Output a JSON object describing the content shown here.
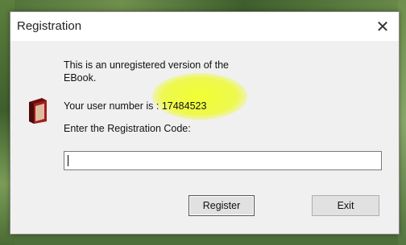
{
  "dialog": {
    "title": "Registration",
    "close_glyph": "✕",
    "message_line1": "This is an unregistered version of the",
    "message_line2": "EBook.",
    "user_number_label": "Your user number is : ",
    "user_number": "17484523",
    "registration_prompt": "Enter the Registration Code:",
    "registration_code_value": "",
    "register_label": "Register",
    "exit_label": "Exit"
  },
  "icons": {
    "dialog_icon": "book-icon",
    "close_icon": "close-icon"
  },
  "colors": {
    "highlight": "#f0ff28",
    "dialog_background": "#f0f0f0",
    "titlebar_background": "#ffffff",
    "icon_book_cover": "#8b1a1a"
  }
}
